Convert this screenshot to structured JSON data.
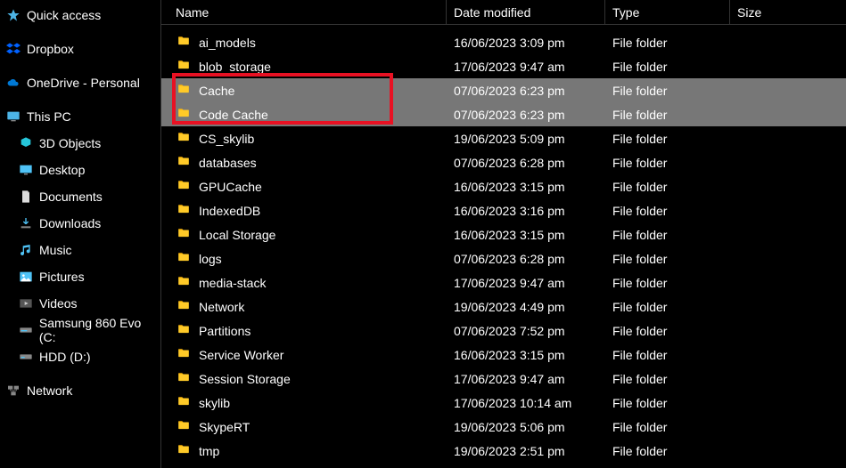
{
  "sidebar": {
    "quick_access": "Quick access",
    "dropbox": "Dropbox",
    "onedrive": "OneDrive - Personal",
    "this_pc": "This PC",
    "pc_items": [
      {
        "label": "3D Objects"
      },
      {
        "label": "Desktop"
      },
      {
        "label": "Documents"
      },
      {
        "label": "Downloads"
      },
      {
        "label": "Music"
      },
      {
        "label": "Pictures"
      },
      {
        "label": "Videos"
      },
      {
        "label": "Samsung 860 Evo (C:"
      },
      {
        "label": " HDD (D:)"
      }
    ],
    "network": "Network"
  },
  "columns": {
    "name": "Name",
    "date": "Date modified",
    "type": "Type",
    "size": "Size"
  },
  "files": [
    {
      "name": "ai_models",
      "date": "16/06/2023 3:09 pm",
      "type": "File folder",
      "selected": false
    },
    {
      "name": "blob_storage",
      "date": "17/06/2023 9:47 am",
      "type": "File folder",
      "selected": false
    },
    {
      "name": "Cache",
      "date": "07/06/2023 6:23 pm",
      "type": "File folder",
      "selected": true
    },
    {
      "name": "Code Cache",
      "date": "07/06/2023 6:23 pm",
      "type": "File folder",
      "selected": true
    },
    {
      "name": "CS_skylib",
      "date": "19/06/2023 5:09 pm",
      "type": "File folder",
      "selected": false
    },
    {
      "name": "databases",
      "date": "07/06/2023 6:28 pm",
      "type": "File folder",
      "selected": false
    },
    {
      "name": "GPUCache",
      "date": "16/06/2023 3:15 pm",
      "type": "File folder",
      "selected": false
    },
    {
      "name": "IndexedDB",
      "date": "16/06/2023 3:16 pm",
      "type": "File folder",
      "selected": false
    },
    {
      "name": "Local Storage",
      "date": "16/06/2023 3:15 pm",
      "type": "File folder",
      "selected": false
    },
    {
      "name": "logs",
      "date": "07/06/2023 6:28 pm",
      "type": "File folder",
      "selected": false
    },
    {
      "name": "media-stack",
      "date": "17/06/2023 9:47 am",
      "type": "File folder",
      "selected": false
    },
    {
      "name": "Network",
      "date": "19/06/2023 4:49 pm",
      "type": "File folder",
      "selected": false
    },
    {
      "name": "Partitions",
      "date": "07/06/2023 7:52 pm",
      "type": "File folder",
      "selected": false
    },
    {
      "name": "Service Worker",
      "date": "16/06/2023 3:15 pm",
      "type": "File folder",
      "selected": false
    },
    {
      "name": "Session Storage",
      "date": "17/06/2023 9:47 am",
      "type": "File folder",
      "selected": false
    },
    {
      "name": "skylib",
      "date": "17/06/2023 10:14 am",
      "type": "File folder",
      "selected": false
    },
    {
      "name": "SkypeRT",
      "date": "19/06/2023 5:06 pm",
      "type": "File folder",
      "selected": false
    },
    {
      "name": "tmp",
      "date": "19/06/2023 2:51 pm",
      "type": "File folder",
      "selected": false
    }
  ]
}
